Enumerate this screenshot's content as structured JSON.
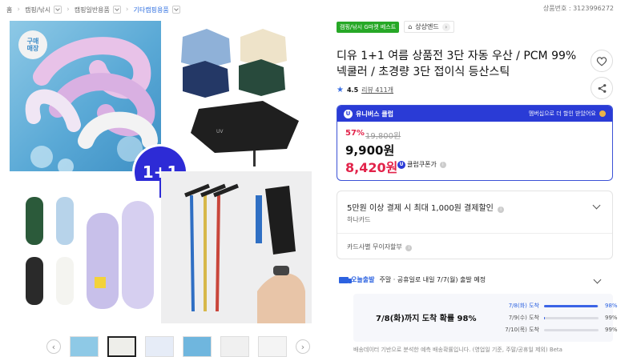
{
  "breadcrumb": {
    "home": "홈",
    "items": [
      "캠핑/낚시",
      "캠핑일반용품",
      "기타캠핑용품"
    ]
  },
  "product_number": "상품번호 : 3123996272",
  "gallery": {
    "store_badge": "구매\n매장",
    "promo_badge": "1+1",
    "umbrella_logo": "UV"
  },
  "thumbnails": {
    "prev_icon": "chevron-left-icon",
    "next_icon": "chevron-right-icon",
    "count": 6,
    "selected_index": 1
  },
  "tags": {
    "best": "캠핑/낚시 G마켓 베스트",
    "store_name": "상상엔드"
  },
  "title": "디유 1+1 여름 상품전 3단 자동 우산 / PCM 99% 넥쿨러 / 초경량 3단 접이식 등산스틱",
  "rating": {
    "score": "4.5",
    "reviews_label": "리뷰 411개"
  },
  "price_card": {
    "header": "유니버스 클럽",
    "header_note": "멤버십으로 더 할인 받았어요",
    "discount": "57%",
    "original": "19,800원",
    "sale": "9,900원",
    "club_price": "8,420원",
    "club_label": "클럽쿠폰가"
  },
  "benefit": {
    "line1": "5만원 이상 결제 시 최대 1,000원 결제할인",
    "card": "하나카드",
    "installment": "카드사별 무이자할부"
  },
  "delivery": {
    "today_label": "오늘출발",
    "headline": "주말 · 공휴일로 내일 7/7(월) 출발 예정",
    "arrival": "7/8(화)까지 도착 확률 98%",
    "rows": [
      {
        "date": "7/8(화) 도착",
        "pct": "98%",
        "value": 0.98
      },
      {
        "date": "7/9(수) 도착",
        "pct": "99%",
        "value": 0.01
      },
      {
        "date": "7/10(목) 도착",
        "pct": "99%",
        "value": 0.0
      }
    ],
    "note": "배송데이터 기반으로 분석한 예측 배송확률입니다. (영업일 기준, 주말/공휴일 제외)  Beta"
  },
  "colors": {
    "accent": "#2a3bd6",
    "sale": "#e2234a",
    "best": "#27a827",
    "delivery": "#2c62e0"
  }
}
